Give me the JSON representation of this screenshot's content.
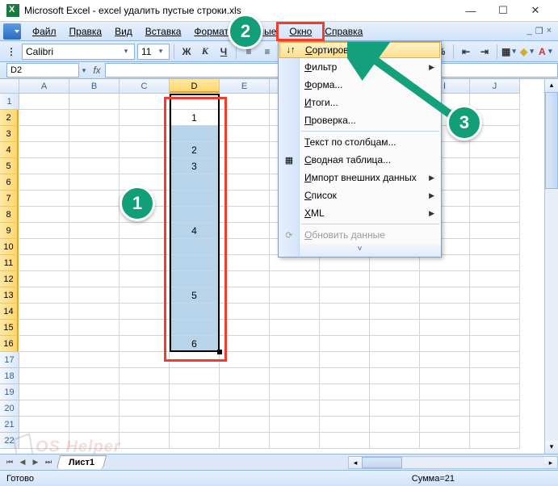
{
  "title": "Microsoft Excel - excel удалить пустые строки.xls",
  "menus": {
    "file": "Файл",
    "edit": "Правка",
    "view": "Вид",
    "insert": "Вставка",
    "format": "Формат",
    "data": "Данные",
    "window": "Окно",
    "help": "Справка"
  },
  "font": {
    "name": "Calibri",
    "size": "11"
  },
  "toolbar": {
    "bold": "Ж",
    "italic": "К",
    "underline": "Ч"
  },
  "namebox": "D2",
  "fx_label": "fx",
  "columns": [
    "A",
    "B",
    "C",
    "D",
    "E",
    "F",
    "G",
    "H",
    "I",
    "J"
  ],
  "rows_visible": 22,
  "selected_col": "D",
  "selected_rows": [
    2,
    16
  ],
  "cell_data": {
    "2": "1",
    "4": "2",
    "5": "3",
    "9": "4",
    "13": "5",
    "16": "6"
  },
  "dropdown": {
    "items": [
      {
        "label": "Сортировка...",
        "hi": true,
        "icon": "sort"
      },
      {
        "label": "Фильтр",
        "sub": true
      },
      {
        "label": "Форма..."
      },
      {
        "label": "Итоги..."
      },
      {
        "label": "Проверка..."
      },
      {
        "sep": true
      },
      {
        "label": "Текст по столбцам..."
      },
      {
        "label": "Сводная таблица...",
        "icon": "pivot"
      },
      {
        "label": "Импорт внешних данных",
        "sub": true
      },
      {
        "label": "Список",
        "sub": true
      },
      {
        "label": "XML",
        "sub": true
      },
      {
        "sep": true
      },
      {
        "label": "Обновить данные",
        "disabled": true,
        "icon": "refresh"
      }
    ],
    "expand": "˅"
  },
  "sheet_tab": "Лист1",
  "status": {
    "ready": "Готово",
    "sum": "Сумма=21"
  },
  "annotations": {
    "n1": "1",
    "n2": "2",
    "n3": "3"
  },
  "watermark": "OS Helper"
}
